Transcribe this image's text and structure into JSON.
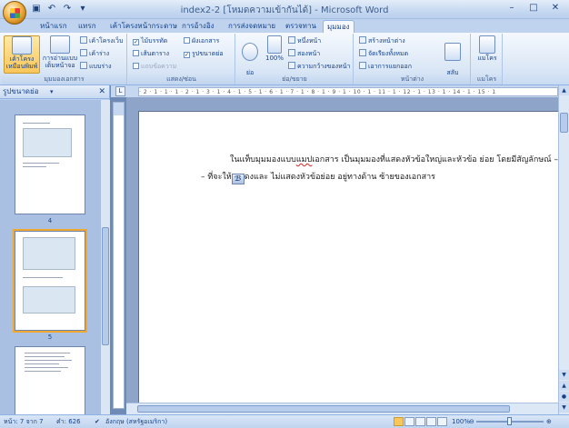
{
  "window": {
    "title": "index2-2 [โหมดความเข้ากันได้] - Microsoft Word",
    "qat_icons": [
      "save-icon",
      "undo-icon",
      "redo-icon",
      "customize-icon"
    ],
    "buttons": {
      "minimize": "–",
      "maximize": "□",
      "close": "✕"
    }
  },
  "tabs": [
    {
      "label": "หน้าแรก"
    },
    {
      "label": "แทรก"
    },
    {
      "label": "เค้าโครงหน้ากระดาษ"
    },
    {
      "label": "การอ้างอิง"
    },
    {
      "label": "การส่งจดหมาย"
    },
    {
      "label": "ตรวจทาน"
    },
    {
      "label": "มุมมอง"
    }
  ],
  "ribbon": {
    "doc_views": {
      "label": "มุมมองเอกสาร",
      "print_layout": "เค้าโครงเหมือนพิมพ์",
      "full_screen": "การอ่านแบบเต็มหน้าจอ",
      "web_layout": "เค้าโครงเว็บ",
      "outline": "เค้าร่าง",
      "draft": "แบบร่าง"
    },
    "show_hide": {
      "label": "แสดง/ซ่อน",
      "ruler": "ไม้บรรทัด",
      "gridlines": "เส้นตาราง",
      "message_bar": "แถบข้อความ",
      "doc_map": "ผังเอกสาร",
      "thumbnails": "รูปขนาดย่อ"
    },
    "zoom": {
      "label": "ย่อ/ขยาย",
      "zoom": "ย่อ\n/ขยาย",
      "hundred": "100%",
      "one_page": "หนึ่งหน้า",
      "two_pages": "สองหน้า",
      "page_width": "ความกว้างของหน้า"
    },
    "window": {
      "label": "หน้าต่าง",
      "new_window": "สร้างหน้าต่าง",
      "arrange_all": "จัดเรียงทั้งหมด",
      "split": "เอาการแยกออก",
      "switch": "สลับ\nหน้าต่าง"
    },
    "macros": {
      "label": "แมโคร",
      "macros": "แมโคร"
    }
  },
  "navpane": {
    "title": "รูปขนาดย่อ",
    "pages": [
      "4",
      "5",
      ""
    ]
  },
  "ruler_text": "· 2 · 1 · 1 · 1 · 2 · 1 · 3 · 1 · 4 · 1 · 5 · 1 · 6 · 1 · 7 · 1 · 8 · 1 · 9 · 1 · 10 · 1 · 11 · 1 · 12 · 1 · 13 · 1 · 14 · 1 · 15 · 1",
  "document": {
    "line1_pre": "ในแท็บมุมมองแบบ",
    "line1_squig": "แมป",
    "line1_post": "เอกสาร เป็นมุมมองที่แสดงหัวข้อใหญ่และหัวข้อ ย่อย โดยมีสัญลักษณ์ – ",
    "line2_pre": "– ที่จะให้",
    "line2_post": "ดงและ ไม่แสดงหัวข้อย่อย อยู่ทางด้าน ซ้ายของเอกสาร"
  },
  "status": {
    "page": "หน้า: 7 จาก 7",
    "words": "คำ: 626",
    "language": "อังกฤษ (สหรัฐอเมริกา)",
    "zoom": "100%"
  }
}
